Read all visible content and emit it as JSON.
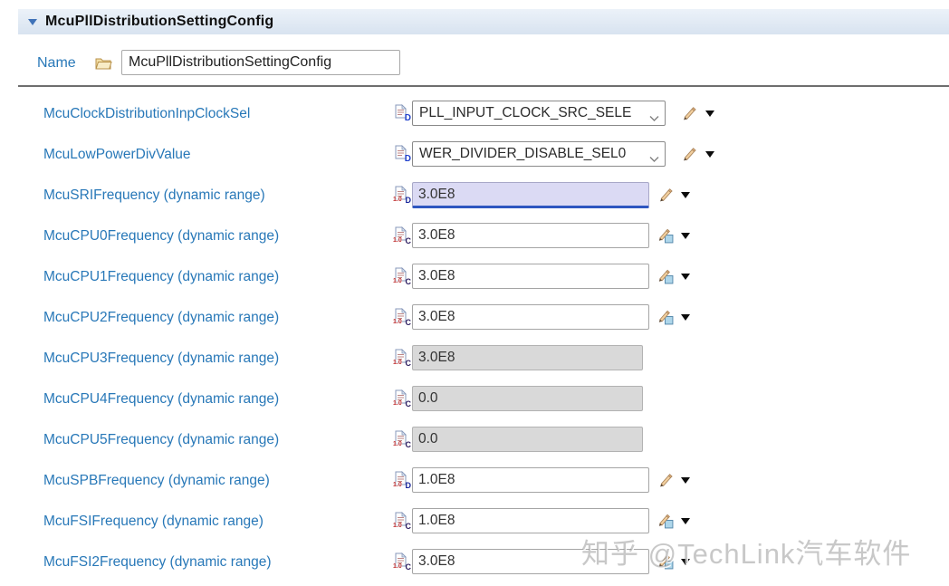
{
  "header": {
    "title": "McuPllDistributionSettingConfig"
  },
  "name_row": {
    "label": "Name",
    "value": "McuPllDistributionSettingConfig"
  },
  "watermark": "知乎 @TechLink汽车软件",
  "colors": {
    "label_blue": "#2878b8",
    "selected_field_bg": "#dbdaf4",
    "selected_underline": "#2e56c0",
    "disabled_bg": "#d9d9d9",
    "header_bg": "#dce6f1"
  },
  "rows": [
    {
      "label": "McuClockDistributionInpClockSel",
      "icon": "enum-d",
      "control": "combo",
      "value": "PLL_INPUT_CLOCK_SRC_SELE",
      "state": "normal",
      "pencil": "plain"
    },
    {
      "label": "McuLowPowerDivValue",
      "icon": "enum-d",
      "control": "combo",
      "value": "WER_DIVIDER_DISABLE_SEL0",
      "state": "normal",
      "pencil": "plain"
    },
    {
      "label": "McuSRIFrequency (dynamic range)",
      "icon": "float-d",
      "control": "text",
      "value": "3.0E8",
      "state": "selected",
      "pencil": "plain"
    },
    {
      "label": "McuCPU0Frequency (dynamic range)",
      "icon": "float-c",
      "control": "text",
      "value": "3.0E8",
      "state": "normal",
      "pencil": "calc"
    },
    {
      "label": "McuCPU1Frequency (dynamic range)",
      "icon": "float-c",
      "control": "text",
      "value": "3.0E8",
      "state": "normal",
      "pencil": "calc"
    },
    {
      "label": "McuCPU2Frequency (dynamic range)",
      "icon": "float-c",
      "control": "text",
      "value": "3.0E8",
      "state": "normal",
      "pencil": "calc"
    },
    {
      "label": "McuCPU3Frequency (dynamic range)",
      "icon": "float-c",
      "control": "text",
      "value": "3.0E8",
      "state": "disabled",
      "pencil": "none"
    },
    {
      "label": "McuCPU4Frequency (dynamic range)",
      "icon": "float-c",
      "control": "text",
      "value": "0.0",
      "state": "disabled",
      "pencil": "none"
    },
    {
      "label": "McuCPU5Frequency (dynamic range)",
      "icon": "float-c",
      "control": "text",
      "value": "0.0",
      "state": "disabled",
      "pencil": "none"
    },
    {
      "label": "McuSPBFrequency (dynamic range)",
      "icon": "float-d",
      "control": "text",
      "value": "1.0E8",
      "state": "normal",
      "pencil": "plain"
    },
    {
      "label": "McuFSIFrequency (dynamic range)",
      "icon": "float-c",
      "control": "text",
      "value": "1.0E8",
      "state": "normal",
      "pencil": "calc"
    },
    {
      "label": "McuFSI2Frequency (dynamic range)",
      "icon": "float-c",
      "control": "text",
      "value": "3.0E8",
      "state": "normal",
      "pencil": "calc"
    }
  ]
}
